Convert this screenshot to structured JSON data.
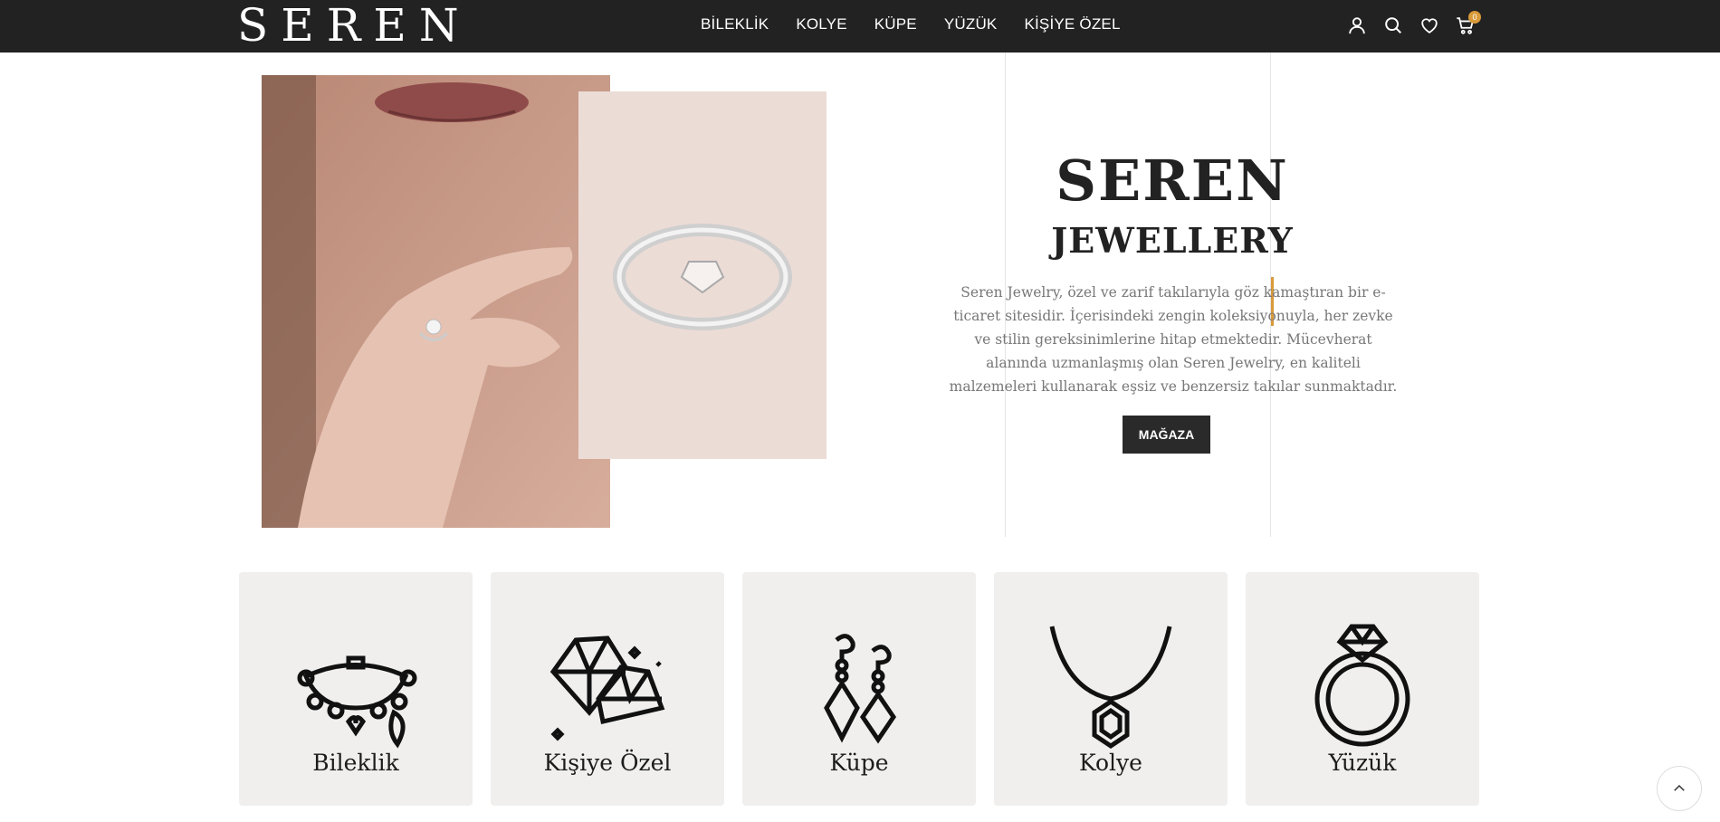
{
  "header": {
    "logo": "SEREN",
    "nav": [
      "BİLEKLİK",
      "KOLYE",
      "KÜPE",
      "YÜZÜK",
      "KİŞİYE ÖZEL"
    ],
    "cart_count": "0",
    "icons": [
      "user-icon",
      "search-icon",
      "heart-icon",
      "cart-icon"
    ]
  },
  "hero": {
    "title": "SEREN",
    "subtitle": "JEWELLERY",
    "description": "Seren Jewelry, özel ve zarif takılarıyla göz kamaştıran bir e-ticaret sitesidir. İçerisindeki zengin koleksiyonuyla, her zevke ve stilin gereksinimlerine hitap etmektedir. Mücevherat alanında uzmanlaşmış olan Seren Jewelry, en kaliteli malzemeleri kullanarak eşsiz ve benzersiz takılar sunmaktadır.",
    "button": "MAĞAZA"
  },
  "categories": [
    {
      "label": "Bileklik",
      "icon": "bracelet-icon"
    },
    {
      "label": "Kişiye Özel",
      "icon": "diamonds-icon"
    },
    {
      "label": "Küpe",
      "icon": "earrings-icon"
    },
    {
      "label": "Kolye",
      "icon": "necklace-icon"
    },
    {
      "label": "Yüzük",
      "icon": "ring-icon"
    }
  ],
  "colors": {
    "header_bg": "#222222",
    "accent": "#d99a3a",
    "card_bg": "#f0efee",
    "button_bg": "#2a2a2a"
  }
}
